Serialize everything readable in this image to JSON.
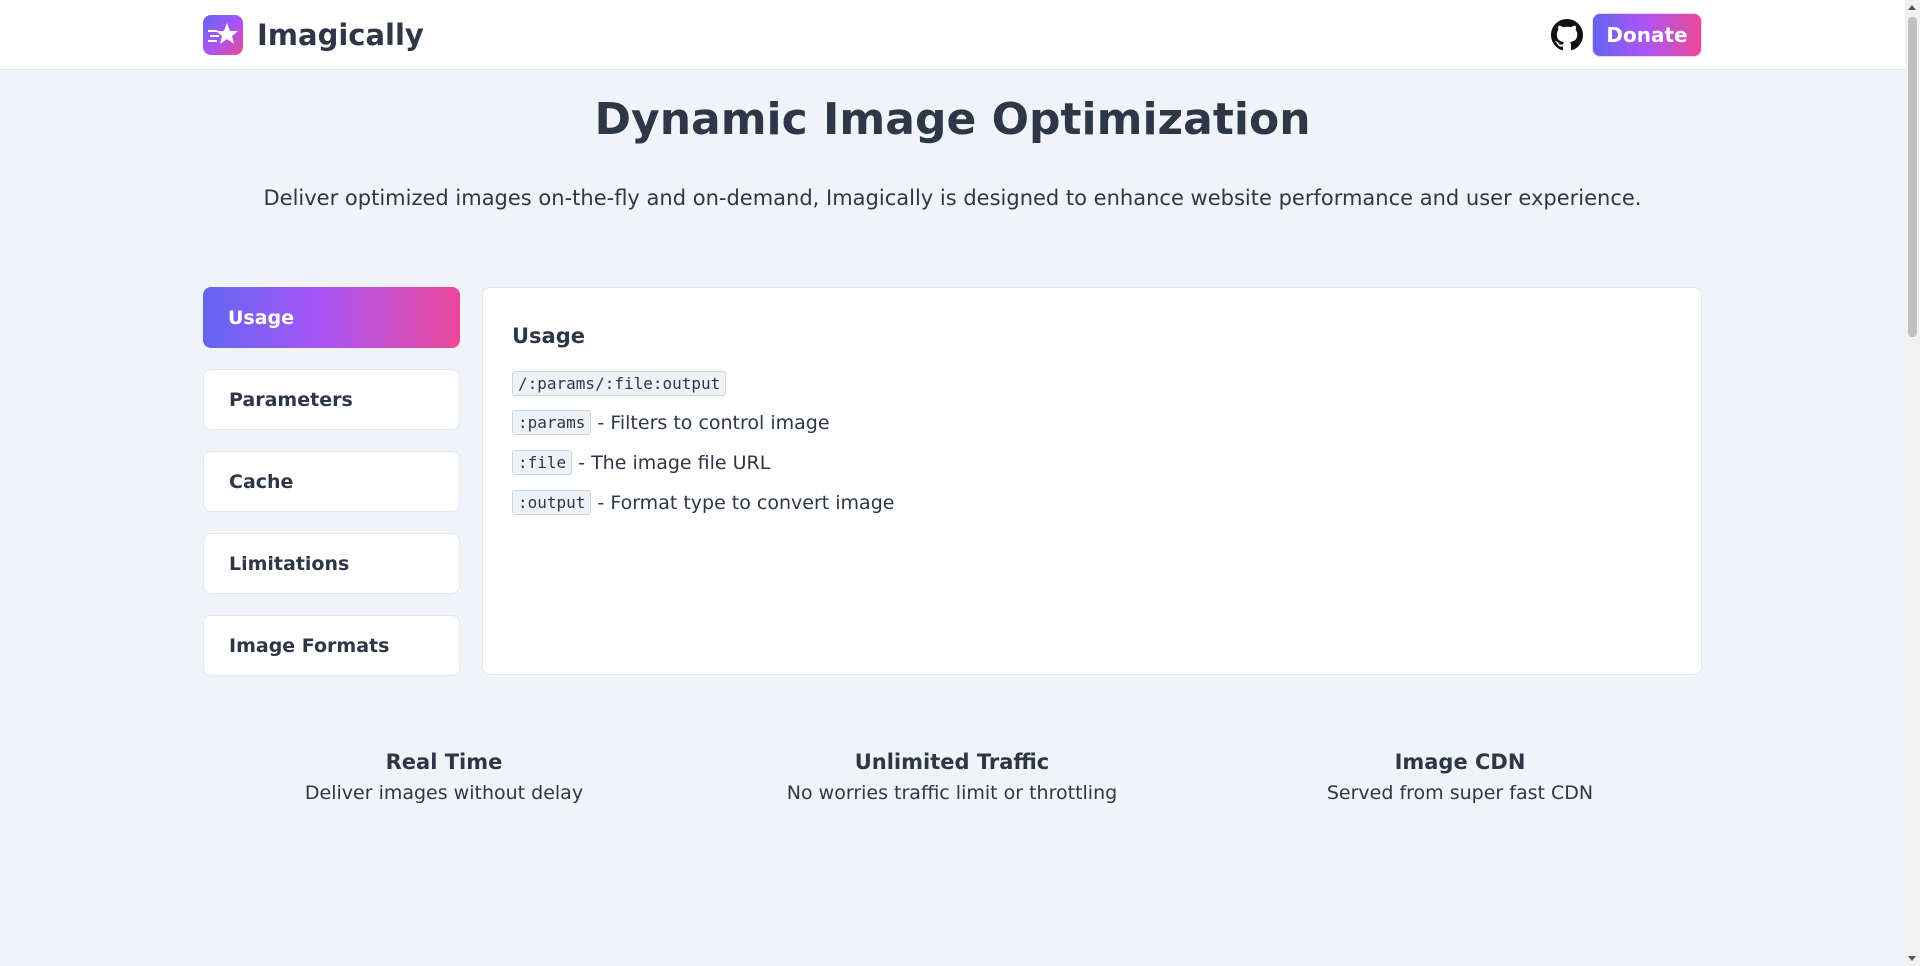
{
  "header": {
    "brand_name": "Imagically",
    "logo_icon": "star-icon",
    "github_icon": "github-icon",
    "donate_label": "Donate"
  },
  "hero": {
    "title": "Dynamic Image Optimization",
    "subtitle": "Deliver optimized images on-the-fly and on-demand, Imagically is designed to enhance website performance and user experience."
  },
  "sidebar": {
    "items": [
      {
        "label": "Usage",
        "active": true
      },
      {
        "label": "Parameters",
        "active": false
      },
      {
        "label": "Cache",
        "active": false
      },
      {
        "label": "Limitations",
        "active": false
      },
      {
        "label": "Image Formats",
        "active": false
      }
    ]
  },
  "panel": {
    "title": "Usage",
    "pattern": "/:params/:file:output",
    "lines": [
      {
        "code": ":params",
        "desc": "- Filters to control image"
      },
      {
        "code": ":file",
        "desc": "- The image file URL"
      },
      {
        "code": ":output",
        "desc": "- Format type to convert image"
      }
    ]
  },
  "features": [
    {
      "title": "Real Time",
      "desc": "Deliver images without delay"
    },
    {
      "title": "Unlimited Traffic",
      "desc": "No worries traffic limit or throttling"
    },
    {
      "title": "Image CDN",
      "desc": "Served from super fast CDN"
    }
  ],
  "colors": {
    "gradient_start": "#6366f1",
    "gradient_mid": "#a855f7",
    "gradient_end": "#ec4899",
    "background": "#f0f4f8",
    "text": "#2d3748"
  }
}
